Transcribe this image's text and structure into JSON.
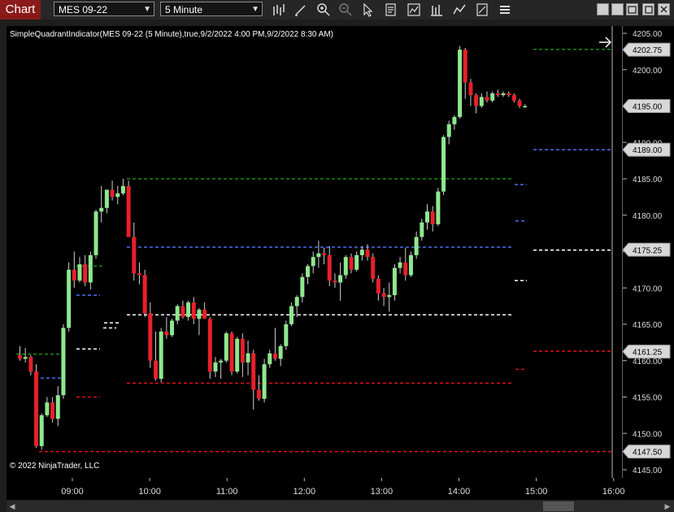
{
  "toolbar": {
    "tab_label": "Chart",
    "instrument": "MES 09-22",
    "interval": "5 Minute",
    "icons": [
      "bar-type-icon",
      "drawing-pencil-icon",
      "zoom-in-icon",
      "zoom-out-icon",
      "pointer-icon",
      "data-box-icon",
      "indicators-icon",
      "strategies-icon",
      "properties-icon"
    ]
  },
  "window_controls": [
    "tile-icon",
    "restore-icon",
    "maximize-icon",
    "close-icon"
  ],
  "chart": {
    "indicator_label": "SimpleQuadrantIndicator(MES 09-22 (5 Minute),true,9/2/2022 4:00 PM,9/2/2022 8:30 AM)",
    "copyright": "© 2022 NinjaTrader, LLC",
    "price_ticks": [
      "4205.00",
      "4200.00",
      "4195.00",
      "4190.00",
      "4185.00",
      "4180.00",
      "4175.00",
      "4170.00",
      "4165.00",
      "4160.00",
      "4155.00",
      "4150.00",
      "4145.00"
    ],
    "price_tags": [
      {
        "label": "4202.75",
        "value": 4202.75,
        "color": "#ffffff"
      },
      {
        "label": "4195.00",
        "value": 4195.0,
        "color": "#ffffff"
      },
      {
        "label": "4189.00",
        "value": 4189.0,
        "color": "#ffffff"
      },
      {
        "label": "4175.25",
        "value": 4175.25,
        "color": "#ffffff"
      },
      {
        "label": "4161.25",
        "value": 4161.25,
        "color": "#ffffff"
      },
      {
        "label": "4147.50",
        "value": 4147.5,
        "color": "#ffffff"
      }
    ],
    "time_ticks": [
      "09:00",
      "10:00",
      "11:00",
      "12:00",
      "13:00",
      "14:00",
      "15:00",
      "16:00"
    ],
    "colors": {
      "up": "#8ee88e",
      "down": "#e8202a",
      "green_line": "#1a8c1a",
      "blue_line": "#4a6cf0",
      "white_line": "#ffffff",
      "red_line": "#e0101c"
    }
  }
}
